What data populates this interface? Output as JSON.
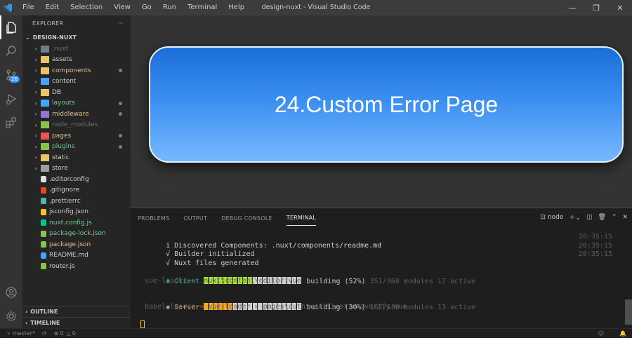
{
  "window": {
    "title": "design-nuxt - Visual Studio Code"
  },
  "menu": [
    "File",
    "Edit",
    "Selection",
    "View",
    "Go",
    "Run",
    "Terminal",
    "Help"
  ],
  "activity": {
    "scm_badge": "26"
  },
  "sidebar": {
    "header": "EXPLORER",
    "more": "···",
    "folder": "DESIGN-NUXT",
    "items": [
      {
        "label": ".nuxt",
        "type": "folder",
        "color": "#6e6e6e",
        "icon": "#6d8086",
        "dot": false
      },
      {
        "label": "assets",
        "type": "folder",
        "color": "#cccccc",
        "icon": "#e8c46a",
        "dot": false
      },
      {
        "label": "components",
        "type": "folder",
        "color": "#e2c08d",
        "icon": "#e8c46a",
        "dot": true
      },
      {
        "label": "content",
        "type": "folder",
        "color": "#cccccc",
        "icon": "#42a5f5",
        "dot": false
      },
      {
        "label": "DB",
        "type": "folder",
        "color": "#cccccc",
        "icon": "#e8c46a",
        "dot": false
      },
      {
        "label": "layouts",
        "type": "folder",
        "color": "#73c991",
        "icon": "#42a5f5",
        "dot": true
      },
      {
        "label": "middleware",
        "type": "folder",
        "color": "#e2c08d",
        "icon": "#9575cd",
        "dot": true
      },
      {
        "label": "node_modules",
        "type": "folder",
        "color": "#6e6e6e",
        "icon": "#8bc34a",
        "dot": false
      },
      {
        "label": "pages",
        "type": "folder",
        "color": "#e2c08d",
        "icon": "#ef5350",
        "dot": true
      },
      {
        "label": "plugins",
        "type": "folder",
        "color": "#73c991",
        "icon": "#8bc34a",
        "dot": true
      },
      {
        "label": "static",
        "type": "folder",
        "color": "#cccccc",
        "icon": "#e8c46a",
        "dot": false
      },
      {
        "label": "store",
        "type": "folder",
        "color": "#cccccc",
        "icon": "#9e9e9e",
        "dot": false
      },
      {
        "label": ".editorconfig",
        "type": "file",
        "color": "#cccccc",
        "icon": "#e0e0e0",
        "dot": false
      },
      {
        "label": ".gitignore",
        "type": "file",
        "color": "#cccccc",
        "icon": "#e64a19",
        "dot": false
      },
      {
        "label": ".prettierrc",
        "type": "file",
        "color": "#cccccc",
        "icon": "#56b3b4",
        "dot": false
      },
      {
        "label": "jsconfig.json",
        "type": "file",
        "color": "#cccccc",
        "icon": "#fbc02d",
        "dot": false
      },
      {
        "label": "nuxt.config.js",
        "type": "file",
        "color": "#73c991",
        "icon": "#00c58e",
        "dot": false
      },
      {
        "label": "package-lock.json",
        "type": "file",
        "color": "#73c991",
        "icon": "#8bc34a",
        "dot": false
      },
      {
        "label": "package.json",
        "type": "file",
        "color": "#e2c08d",
        "icon": "#8bc34a",
        "dot": false
      },
      {
        "label": "README.md",
        "type": "file",
        "color": "#cccccc",
        "icon": "#42a5f5",
        "dot": false
      },
      {
        "label": "router.js",
        "type": "file",
        "color": "#cccccc",
        "icon": "#8bc34a",
        "dot": false
      }
    ],
    "outline": "OUTLINE",
    "timeline": "TIMELINE"
  },
  "editor": {
    "banner": "24.Custom Error Page"
  },
  "panel": {
    "tabs": [
      "PROBLEMS",
      "OUTPUT",
      "DEBUG CONSOLE",
      "TERMINAL"
    ],
    "active_tab": "TERMINAL",
    "terminal_name": "node",
    "lines": [
      {
        "text": "i Discovered Components: .nuxt/components/readme.md",
        "ts": "20:35:15"
      },
      {
        "text": "√ Builder initialized",
        "ts": "20:35:15"
      },
      {
        "text": "√ Nuxt files generated",
        "ts": "20:35:15"
      }
    ],
    "client": {
      "prefix": "✱ Client ",
      "status": " building (52%) ",
      "detail": "351/368 modules 17 active",
      "sub": " vue-loader » .nuxt\\content\\editor.vue",
      "progress": 0.52,
      "color": "#a6e22e"
    },
    "server": {
      "prefix": "✱ Server ",
      "status": " building (30%) ",
      "detail": "167/180 modules 13 active",
      "sub": " babel-loader » vue-loader » pages\\auth\\verification\\verify.vue",
      "progress": 0.3,
      "color": "#f5a623"
    }
  },
  "status": {
    "branch": "master*",
    "errors": "0",
    "warnings": "0"
  }
}
